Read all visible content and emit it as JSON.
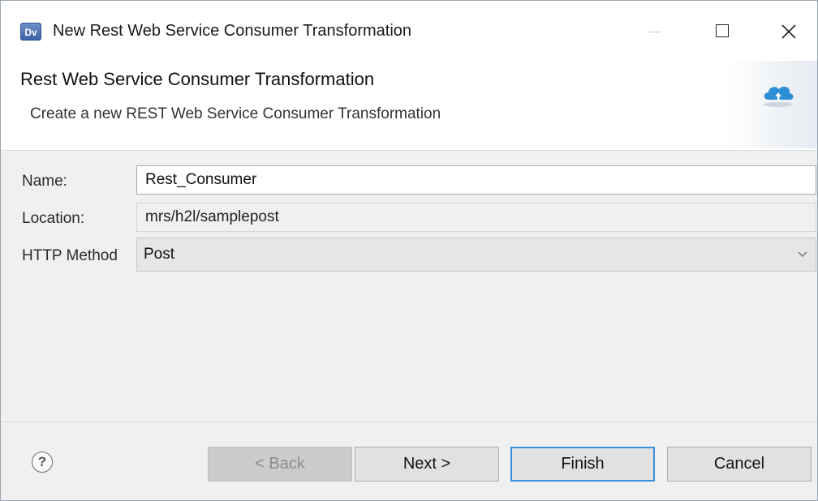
{
  "window": {
    "title": "New Rest Web Service Consumer Transformation",
    "app_icon_text": "Dv"
  },
  "header": {
    "title": "Rest Web Service Consumer Transformation",
    "description": "Create a new REST Web Service Consumer Transformation",
    "banner_icon": "cloud-icon"
  },
  "form": {
    "name_label": "Name:",
    "name_value": "Rest_Consumer",
    "location_label": "Location:",
    "location_value": "mrs/h2l/samplepost",
    "method_label": "HTTP Method",
    "method_value": "Post"
  },
  "footer": {
    "help_symbol": "?",
    "back_label": "< Back",
    "next_label": "Next >",
    "finish_label": "Finish",
    "cancel_label": "Cancel"
  },
  "colors": {
    "accent": "#3c8fd9",
    "window_background": "#f0f0f0"
  }
}
